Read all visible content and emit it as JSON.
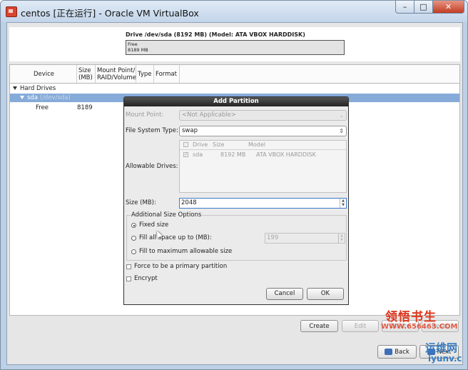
{
  "window": {
    "title": "centos [正在运行] - Oracle VM VirtualBox",
    "min_glyph": "–",
    "max_glyph": "□",
    "close_glyph": "✕"
  },
  "drive": {
    "title": "Drive /dev/sda (8192 MB) (Model: ATA VBOX HARDDISK)",
    "bar_label": "Free",
    "bar_size": "8189 MB"
  },
  "table": {
    "columns": [
      "Device",
      "Size\n(MB)",
      "Mount Point/\nRAID/Volume",
      "Type",
      "Format"
    ],
    "group": "Hard Drives",
    "disk": "sda",
    "disk_path": "(/dev/sda)",
    "free_label": "Free",
    "free_size": "8189"
  },
  "page_buttons": {
    "create": "Create",
    "edit": "Edit",
    "delete": "Delete",
    "reset": "Reset",
    "back": "Back",
    "next": "Next"
  },
  "watermarks": {
    "brand_cn": "领悟书生",
    "brand_url": "WWW.656463.COM",
    "site_cn": "运维网",
    "site_url": "iyunv.com"
  },
  "dialog": {
    "title": "Add Partition",
    "mount_label": "Mount Point:",
    "mount_value": "<Not Applicable>",
    "fs_label": "File System Type:",
    "fs_value": "swap",
    "drives_label": "Allowable Drives:",
    "drive_columns": [
      "Drive",
      "Size",
      "Model"
    ],
    "drive_row": {
      "drive": "sda",
      "size": "8192 MB",
      "model": "ATA VBOX HARDDISK"
    },
    "size_label": "Size (MB):",
    "size_value": "2048",
    "options_title": "Additional Size Options",
    "opt_fixed": "Fixed size",
    "opt_fill_upto": "Fill all space up to (MB):",
    "fill_upto_value": "199",
    "opt_fill_max": "Fill to maximum allowable size",
    "force_primary": "Force to be a primary partition",
    "encrypt": "Encrypt",
    "cancel": "Cancel",
    "ok": "OK",
    "selected_option": "fixed"
  },
  "colors": {
    "selection": "#86abd9",
    "dialog_title_bg": "#2b2b2b",
    "close_button": "#c8472d",
    "watermark_red": "#e0361c"
  }
}
